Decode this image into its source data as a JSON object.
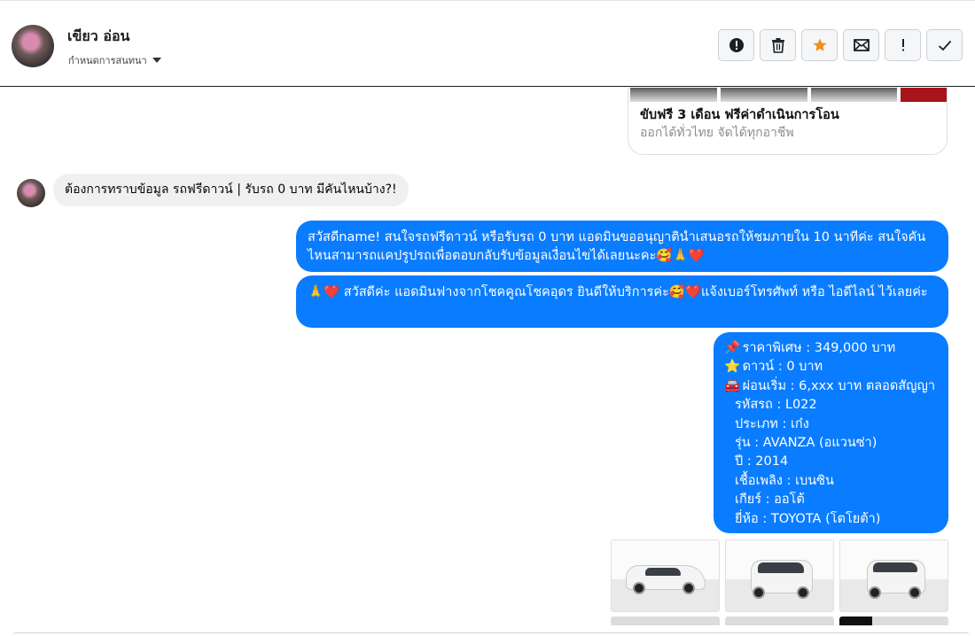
{
  "header": {
    "contact_name": "เขียว อ่อน",
    "contact_sub": "กำหนดการสนทนา",
    "actions": [
      {
        "name": "report",
        "label": "!"
      },
      {
        "name": "delete"
      },
      {
        "name": "star"
      },
      {
        "name": "mail"
      },
      {
        "name": "important",
        "label": "!"
      },
      {
        "name": "done"
      }
    ],
    "star_color": "#f28f1c"
  },
  "card": {
    "title": "ขับฟรี 3 เดือน ฟรีค่าดำเนินการโอน",
    "subtitle": "ออกได้ทั่วไทย จัดได้ทุกอาชีพ"
  },
  "messages": {
    "incoming": "ต้องการทราบข้อมูล รถฟรีดาวน์ | รับรถ 0 บาท มีคันไหนบ้าง?!",
    "out1": "สวัสดีname! สนใจรถฟรีดาวน์ หรือรับรถ 0 บาท แอดมินขออนุญาตินำเสนอรถให้ชมภายใน 10 นาทีค่ะ สนใจคันไหนสามารถแคปรูปรถเพื่อตอบกลับรับข้อมูลเงื่อนไขได้เลยนะคะ🥰🙏❤️",
    "out2": "🙏❤️ สวัสดีค่ะ แอดมินฟางจากโชคคูณโชคอุดร ยินดีให้บริการค่ะ🥰❤️แจ้งเบอร์โทรศัพท์ หรือ ไอดีไลน์  ไว้เลยค่ะ",
    "details": {
      "price": "ราคาพิเศษ : 349,000 บาท",
      "down": "ดาวน์ : 0 บาท",
      "installment": "ผ่อนเริ่ม : 6,xxx บาท ตลอดสัญญา",
      "code": "รหัสรถ : L022",
      "type": "ประเภท : เก๋ง",
      "model": "รุ่น : AVANZA (อแวนซ่า)",
      "year": "ปี : 2014",
      "fuel": "เชื้อเพลิง : เบนซิน",
      "gear": "เกียร์ : ออโต้",
      "brand": "ยี่ห้อ : TOYOTA (โตโยต้า)"
    }
  },
  "colors": {
    "bubble_out": "#0a7cff",
    "bubble_in": "#f0f0f0"
  }
}
